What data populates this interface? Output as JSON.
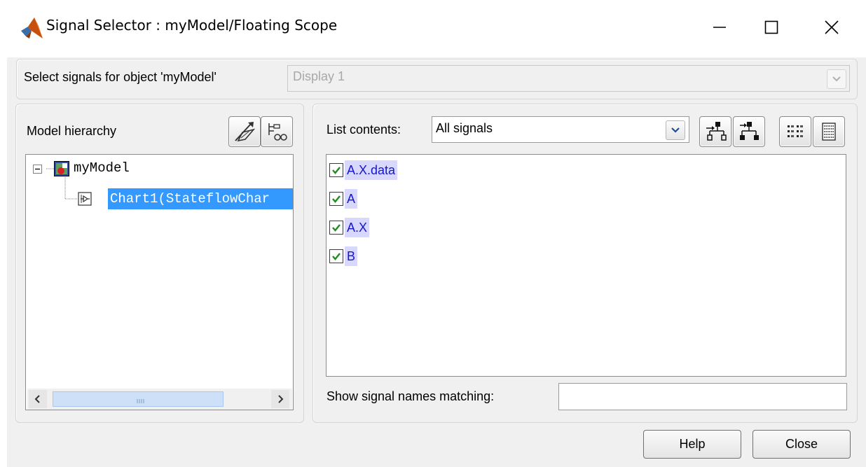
{
  "window": {
    "title": "Signal Selector : myModel/Floating Scope",
    "icon": "matlab-icon",
    "controls": {
      "minimize": "—",
      "maximize": "☐",
      "close": "✕"
    }
  },
  "selector": {
    "label": "Select signals for object 'myModel'",
    "value": "Display 1"
  },
  "hierarchy": {
    "label": "Model hierarchy",
    "tools": [
      "highlight-in-model-icon",
      "show-subsystems-icon"
    ],
    "root": "myModel",
    "child": "Chart1(StateflowChar"
  },
  "list": {
    "label": "List contents:",
    "value": "All signals",
    "tools": [
      "flat-list-icon",
      "hierarchical-list-icon",
      "detail-view-icon",
      "list-view-icon"
    ]
  },
  "signals": [
    {
      "name": "A.X.data",
      "checked": true
    },
    {
      "name": "A",
      "checked": true
    },
    {
      "name": "A.X",
      "checked": true
    },
    {
      "name": "B",
      "checked": true
    }
  ],
  "filter": {
    "label": "Show signal names matching:",
    "value": ""
  },
  "buttons": {
    "help": "Help",
    "close": "Close"
  },
  "colors": {
    "selection": "#3399ff",
    "signal_text": "#1515d0",
    "signal_highlight": "#d8d8ff",
    "check": "#1e8c1e"
  }
}
